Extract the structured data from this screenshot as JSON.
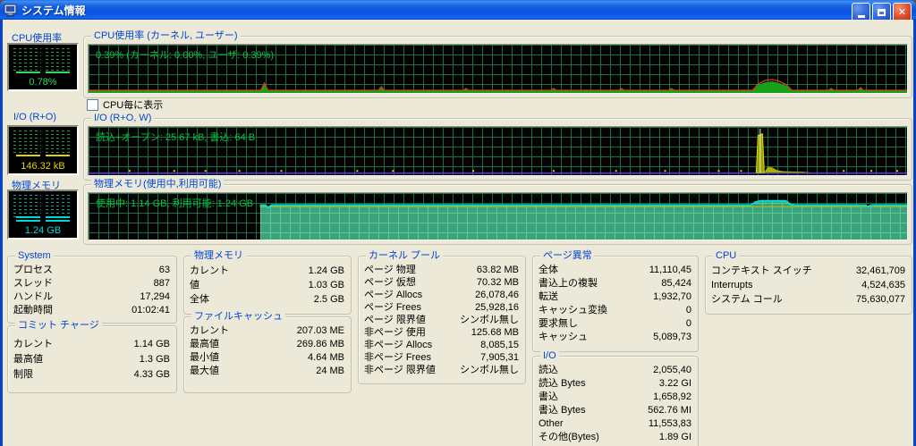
{
  "window": {
    "title": "システム情報",
    "buttons": {
      "minimize": "minimize",
      "maximize": "maximize",
      "close": "close"
    }
  },
  "colors": {
    "titlebar_blue": "#0a55dd",
    "desktop_beige": "#ece9d8",
    "group_label_blue": "#0046d5",
    "graph_bg": "#040404",
    "graph_grid_green": "#1c6f44",
    "graph_text_green": "#00c43e",
    "cpu_line_red": "#d04020",
    "cpu_fill_green": "#18a018",
    "io_line_violet": "#7a45d8",
    "io_spike_yellow": "#d8d400",
    "mem_fill_teal": "#3ba27b",
    "mem_line_cyan": "#00e0e0",
    "gauge_cpu_green": "#30d860",
    "gauge_io_yellow": "#ded400",
    "gauge_mem_cyan": "#00d8d8"
  },
  "checkbox": {
    "label": "CPU毎に表示",
    "checked": false
  },
  "gauges": {
    "cpu": {
      "label": "CPU使用率",
      "value": "0.78%"
    },
    "io": {
      "label": "I/O (R+O)",
      "value": "146.32 kB"
    },
    "mem": {
      "label": "物理メモリ",
      "value": "1.24 GB"
    }
  },
  "graphs": {
    "cpu": {
      "label": "CPU使用率 (カーネル, ユーザー)",
      "overlay": "0.39% (カーネル: 0.00%, ユーザ: 0.39%)"
    },
    "io": {
      "label": "I/O (R+O, W)",
      "overlay": "読込+オープン: 25.67 kB, 書込: 64 B"
    },
    "mem": {
      "label": "物理メモリ(使用中,利用可能)",
      "overlay": "使用中: 1.14 GB, 利用可能: 1.24 GB"
    }
  },
  "stats": {
    "system": {
      "title": "System",
      "rows": [
        [
          "プロセス",
          "63"
        ],
        [
          "スレッド",
          "887"
        ],
        [
          "ハンドル",
          "17,294"
        ],
        [
          "起動時間",
          "01:02:41"
        ]
      ]
    },
    "commit": {
      "title": "コミット チャージ",
      "rows": [
        [
          "カレント",
          "1.14 GB"
        ],
        [
          "最高値",
          "1.3 GB"
        ],
        [
          "制限",
          "4.33 GB"
        ]
      ]
    },
    "physical_memory": {
      "title": "物理メモリ",
      "rows": [
        [
          "カレント",
          "1.24 GB"
        ],
        [
          "値",
          "1.03 GB"
        ],
        [
          "全体",
          "2.5 GB"
        ]
      ]
    },
    "file_cache": {
      "title": "ファイルキャッシュ",
      "rows": [
        [
          "カレント",
          "207.03 ME"
        ],
        [
          "最高値",
          "269.86 MB"
        ],
        [
          "最小値",
          "4.64 MB"
        ],
        [
          "最大値",
          "24 MB"
        ]
      ]
    },
    "kernel_pool": {
      "title": "カーネル プール",
      "rows": [
        [
          "ページ 物理",
          "63.82 MB"
        ],
        [
          "ページ 仮想",
          "70.32 MB"
        ],
        [
          "ページ Allocs",
          "26,078,46"
        ],
        [
          "ページ Frees",
          "25,928,16"
        ],
        [
          "ページ 限界値",
          "シンボル無し"
        ],
        [
          "非ページ 使用",
          "125.68 MB"
        ],
        [
          "非ページ Allocs",
          "8,085,15"
        ],
        [
          "非ページ Frees",
          "7,905,31"
        ],
        [
          "非ページ 限界値",
          "シンボル無し"
        ]
      ]
    },
    "page_faults": {
      "title": "ページ異常",
      "rows": [
        [
          "全体",
          "11,110,45"
        ],
        [
          "書込上の複製",
          "85,424"
        ],
        [
          "転送",
          "1,932,70"
        ],
        [
          "キャッシュ変換",
          "0"
        ],
        [
          "要求無し",
          "0"
        ],
        [
          "キャッシュ",
          "5,089,73"
        ]
      ]
    },
    "io": {
      "title": "I/O",
      "rows": [
        [
          "読込",
          "2,055,40"
        ],
        [
          "読込 Bytes",
          "3.22 GI"
        ],
        [
          "書込",
          "1,658,92"
        ],
        [
          "書込 Bytes",
          "562.76 MI"
        ],
        [
          "Other",
          "11,553,83"
        ],
        [
          "その他(Bytes)",
          "1.89 GI"
        ]
      ]
    },
    "cpu": {
      "title": "CPU",
      "rows": [
        [
          "コンテキスト スイッチ",
          "32,461,709"
        ],
        [
          "Interrupts",
          "4,524,635"
        ],
        [
          "システム コール",
          "75,630,077"
        ]
      ]
    }
  }
}
